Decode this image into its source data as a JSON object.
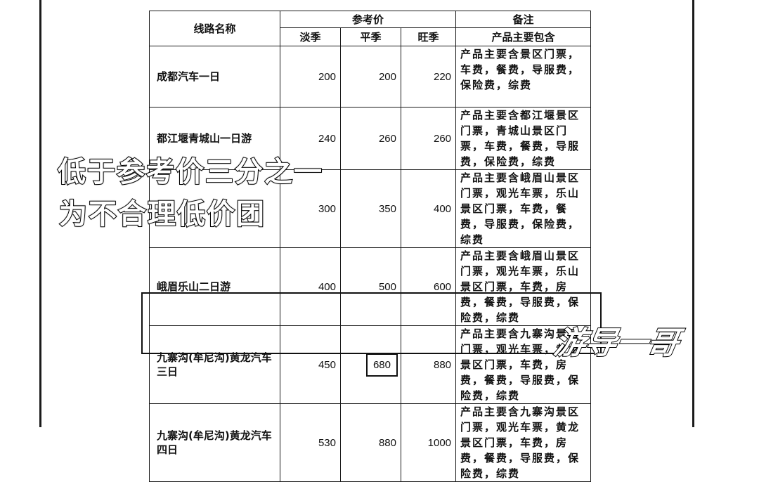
{
  "table": {
    "header": {
      "route_name": "线路名称",
      "reference_price": "参考价",
      "low_season": "淡季",
      "regular_season": "平季",
      "peak_season": "旺季",
      "remarks": "备注",
      "remarks_sub": "产品主要包含"
    },
    "rows": [
      {
        "name": "成都汽车一日",
        "low": "200",
        "regular": "200",
        "peak": "220",
        "note": "产品主要含景区门票，车费，餐费，导服费，保险费，综费"
      },
      {
        "name": "都江堰青城山一日游",
        "low": "240",
        "regular": "260",
        "peak": "260",
        "note": "产品主要含都江堰景区门票，青城山景区门票，车费，餐费，导服费，保险费，综费"
      },
      {
        "name": "",
        "low": "300",
        "regular": "350",
        "peak": "400",
        "note": "产品主要含峨眉山景区门票，观光车票，乐山景区门票，车费，餐费，导服费，保险费，综费"
      },
      {
        "name": "峨眉乐山二日游",
        "low": "400",
        "regular": "500",
        "peak": "600",
        "note": "产品主要含峨眉山景区门票，观光车票，乐山景区门票，车费，房费，餐费，导服费，保险费，综费"
      },
      {
        "name": "九寨沟(牟尼沟)黄龙汽车三日",
        "low": "450",
        "regular": "680",
        "peak": "880",
        "note": "产品主要含九寨沟景区门票，观光车票，黄龙景区门票，车费，房费，餐费，导服费，保险费，综费"
      },
      {
        "name": "九寨沟(牟尼沟)黄龙汽车四日",
        "low": "530",
        "regular": "880",
        "peak": "1000",
        "note": "产品主要含九寨沟景区门票，观光车票，黄龙景区门票，车费，房费，餐费，导服费，保险费，综费"
      }
    ]
  },
  "overlay": {
    "line1": "低于参考价三分之一",
    "line2": "为不合理低价团",
    "watermark": "游导一哥"
  }
}
